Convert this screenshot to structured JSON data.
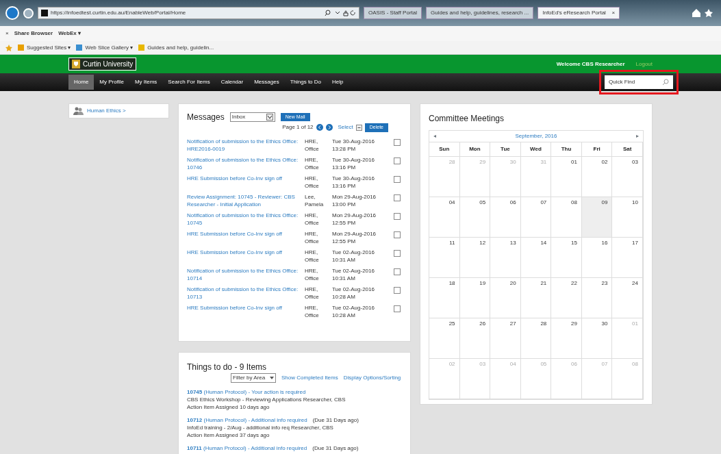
{
  "browser": {
    "address": "https://infoedtest.curtin.edu.au/EnableWeb/Portal/Home",
    "tabs": [
      {
        "label": "OASIS - Staff Portal",
        "selected": false
      },
      {
        "label": "Guides and help, guidelines, research ...",
        "selected": false
      },
      {
        "label": "InfoEd's eResearch Portal",
        "selected": true,
        "close": "×"
      }
    ],
    "close_bar": "×",
    "command_bar": [
      "Share Browser",
      "WebEx ▾"
    ],
    "favorites": [
      "Suggested Sites ▾",
      "Web Slice Gallery ▾",
      "Guides and help, guidelin..."
    ]
  },
  "header": {
    "logo_text": "Curtin University",
    "welcome": "Welcome CBS Researcher",
    "logout": "Logout"
  },
  "nav": {
    "items": [
      {
        "label": "Home",
        "selected": true
      },
      {
        "label": "My Profile",
        "selected": false
      },
      {
        "label": "My Items",
        "selected": false
      },
      {
        "label": "Search For Items",
        "selected": false
      },
      {
        "label": "Calendar",
        "selected": false
      },
      {
        "label": "Messages",
        "selected": false
      },
      {
        "label": "Things to Do",
        "selected": false
      },
      {
        "label": "Help",
        "selected": false
      }
    ],
    "quick_find": {
      "placeholder": "Quick Find"
    }
  },
  "sidebar": {
    "items": [
      "Human Ethics >"
    ]
  },
  "messages": {
    "title": "Messages",
    "folder": "Inbox",
    "new_mail": "New Mail",
    "page": "Page 1 of 12",
    "select": "Select",
    "delete": "Delete",
    "rows": [
      {
        "subject": "Notification of submission to the Ethics Office: HRE2016-0019",
        "from": "HRE, Office",
        "date": "Tue 30-Aug-2016",
        "time": "13:28 PM",
        "checked": false
      },
      {
        "subject": "Notification of submission to the Ethics Office: 10746",
        "from": "HRE, Office",
        "date": "Tue 30-Aug-2016",
        "time": "13:16 PM",
        "checked": false
      },
      {
        "subject": "HRE Submission before Co-Inv sign off",
        "from": "HRE, Office",
        "date": "Tue 30-Aug-2016",
        "time": "13:16 PM",
        "checked": false
      },
      {
        "subject": "Review Assignment: 10745 - Reviewer: CBS Researcher - Initial Application",
        "from": "Lee, Pamela",
        "date": "Mon 29-Aug-2016",
        "time": "13:00 PM",
        "checked": false
      },
      {
        "subject": "Notification of submission to the Ethics Office: 10745",
        "from": "HRE, Office",
        "date": "Mon 29-Aug-2016",
        "time": "12:55 PM",
        "checked": false
      },
      {
        "subject": "HRE Submission before Co-Inv sign off",
        "from": "HRE, Office",
        "date": "Mon 29-Aug-2016",
        "time": "12:55 PM",
        "checked": false
      },
      {
        "subject": "HRE Submission before Co-Inv sign off",
        "from": "HRE, Office",
        "date": "Tue 02-Aug-2016",
        "time": "10:31 AM",
        "checked": false
      },
      {
        "subject": "Notification of submission to the Ethics Office: 10714",
        "from": "HRE, Office",
        "date": "Tue 02-Aug-2016",
        "time": "10:31 AM",
        "checked": false
      },
      {
        "subject": "Notification of submission to the Ethics Office: 10713",
        "from": "HRE, Office",
        "date": "Tue 02-Aug-2016",
        "time": "10:28 AM",
        "checked": false
      },
      {
        "subject": "HRE Submission before Co-Inv sign off",
        "from": "HRE, Office",
        "date": "Tue 02-Aug-2016",
        "time": "10:28 AM",
        "checked": false
      }
    ]
  },
  "todo": {
    "title": "Things to do - 9 Items",
    "filter": "Filter by Area",
    "links": [
      "Show Completed Items",
      "Display Options/Sorting"
    ],
    "items": [
      {
        "link": "**10745** (Human Protocol) - Your action is required",
        "lines": [
          "CBS Ethics Workshop - Reviewing Applications Researcher, CBS",
          "Action Item Assigned 10 days ago"
        ]
      },
      {
        "link": "**10712** (Human Protocol) - Additional info required",
        "due": "(Due 31 Days ago)",
        "lines": [
          "InfoEd training - 2/Aug - additional info req Researcher, CBS",
          "Action Item Assigned 37 days ago"
        ]
      },
      {
        "link": "**10711** (Human Protocol) - Additional info required",
        "due": "(Due 31 Days ago)"
      }
    ]
  },
  "calendar": {
    "title": "Committee Meetings",
    "prev": "◂",
    "month": "September, 2016",
    "next": "▸",
    "weekdays": [
      "Sun",
      "Mon",
      "Tue",
      "Wed",
      "Thu",
      "Fri",
      "Sat"
    ],
    "weeks": [
      [
        {
          "day": "28",
          "other_month": true,
          "today": false
        },
        {
          "day": "29",
          "other_month": true,
          "today": false
        },
        {
          "day": "30",
          "other_month": true,
          "today": false
        },
        {
          "day": "31",
          "other_month": true,
          "today": false
        },
        {
          "day": "01",
          "other_month": false,
          "today": false
        },
        {
          "day": "02",
          "other_month": false,
          "today": false
        },
        {
          "day": "03",
          "other_month": false,
          "today": false
        }
      ],
      [
        {
          "day": "04",
          "other_month": false,
          "today": false
        },
        {
          "day": "05",
          "other_month": false,
          "today": false
        },
        {
          "day": "06",
          "other_month": false,
          "today": false
        },
        {
          "day": "07",
          "other_month": false,
          "today": false
        },
        {
          "day": "08",
          "other_month": false,
          "today": false
        },
        {
          "day": "09",
          "other_month": false,
          "today": true
        },
        {
          "day": "10",
          "other_month": false,
          "today": false
        }
      ],
      [
        {
          "day": "11",
          "other_month": false,
          "today": false
        },
        {
          "day": "12",
          "other_month": false,
          "today": false
        },
        {
          "day": "13",
          "other_month": false,
          "today": false
        },
        {
          "day": "14",
          "other_month": false,
          "today": false
        },
        {
          "day": "15",
          "other_month": false,
          "today": false
        },
        {
          "day": "16",
          "other_month": false,
          "today": false
        },
        {
          "day": "17",
          "other_month": false,
          "today": false
        }
      ],
      [
        {
          "day": "18",
          "other_month": false,
          "today": false
        },
        {
          "day": "19",
          "other_month": false,
          "today": false
        },
        {
          "day": "20",
          "other_month": false,
          "today": false
        },
        {
          "day": "21",
          "other_month": false,
          "today": false
        },
        {
          "day": "22",
          "other_month": false,
          "today": false
        },
        {
          "day": "23",
          "other_month": false,
          "today": false
        },
        {
          "day": "24",
          "other_month": false,
          "today": false
        }
      ],
      [
        {
          "day": "25",
          "other_month": false,
          "today": false
        },
        {
          "day": "26",
          "other_month": false,
          "today": false
        },
        {
          "day": "27",
          "other_month": false,
          "today": false
        },
        {
          "day": "28",
          "other_month": false,
          "today": false
        },
        {
          "day": "29",
          "other_month": false,
          "today": false
        },
        {
          "day": "30",
          "other_month": false,
          "today": false
        },
        {
          "day": "01",
          "other_month": true,
          "today": false
        }
      ],
      [
        {
          "day": "02",
          "other_month": true,
          "today": false
        },
        {
          "day": "03",
          "other_month": true,
          "today": false
        },
        {
          "day": "04",
          "other_month": true,
          "today": false
        },
        {
          "day": "05",
          "other_month": true,
          "today": false
        },
        {
          "day": "06",
          "other_month": true,
          "today": false
        },
        {
          "day": "07",
          "other_month": true,
          "today": false
        },
        {
          "day": "08",
          "other_month": true,
          "today": false
        }
      ]
    ]
  }
}
